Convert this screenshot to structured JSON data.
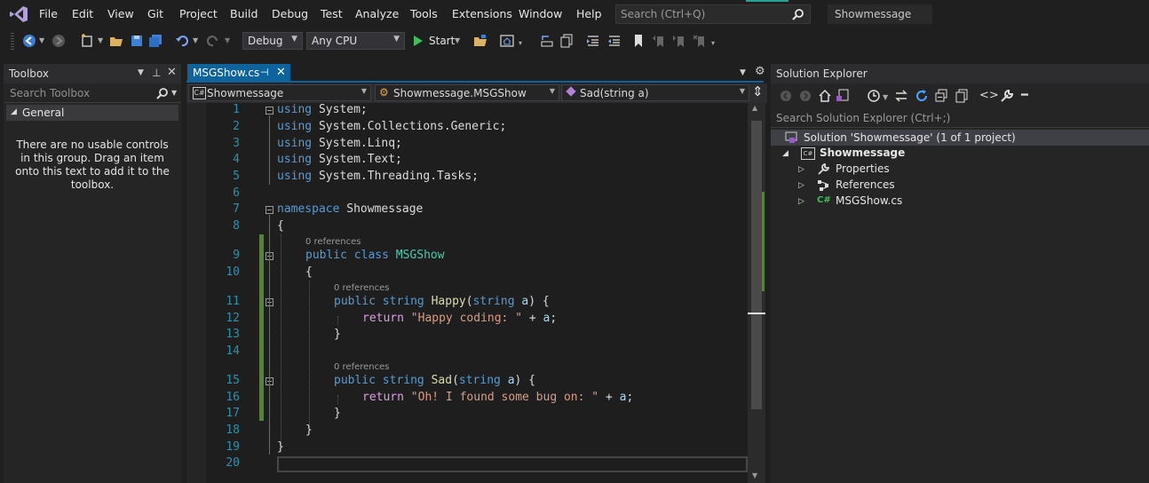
{
  "menu": [
    "File",
    "Edit",
    "View",
    "Git",
    "Project",
    "Build",
    "Debug",
    "Test",
    "Analyze",
    "Tools",
    "Extensions",
    "Window",
    "Help"
  ],
  "search": {
    "placeholder": "Search (Ctrl+Q)"
  },
  "window_title": "Showmessage",
  "toolbar": {
    "config": "Debug",
    "platform": "Any CPU",
    "start_label": "Start"
  },
  "toolbox": {
    "title": "Toolbox",
    "search_placeholder": "Search Toolbox",
    "group": "General",
    "empty_message": "There are no usable controls in this group. Drag an item onto this text to add it to the toolbox."
  },
  "editor": {
    "tab_label": "MSGShow.cs",
    "nav_project": "Showmessage",
    "nav_class": "Showmessage.MSGShow",
    "nav_member": "Sad(string a)",
    "line_numbers": [
      "1",
      "2",
      "3",
      "4",
      "5",
      "6",
      "7",
      "8",
      "9",
      "10",
      "11",
      "12",
      "13",
      "14",
      "15",
      "16",
      "17",
      "18",
      "19",
      "20"
    ],
    "lens_class": "0 references",
    "lens_happy": "0 references",
    "lens_sad": "0 references",
    "code": {
      "l1_kw": "using",
      "l1_rest": " System;",
      "l2_kw": "using",
      "l2_rest": " System.Collections.Generic;",
      "l3_kw": "using",
      "l3_rest": " System.Linq;",
      "l4_kw": "using",
      "l4_rest": " System.Text;",
      "l5_kw": "using",
      "l5_rest": " System.Threading.Tasks;",
      "l7_kw": "namespace",
      "l7_rest": " Showmessage",
      "l8": "{",
      "l9_kw1": "public",
      "l9_kw2": "class",
      "l9_type": "MSGShow",
      "l10": "{",
      "l11_kw1": "public",
      "l11_kw2": "string",
      "l11_fn": "Happy",
      "l11_p1": "(",
      "l11_kw3": "string",
      "l11_pm": "a",
      "l11_p2": ") {",
      "l12_kw": "return",
      "l12_str": "\"Happy coding: \"",
      "l12_op": " + ",
      "l12_pm": "a",
      "l12_end": ";",
      "l13": "}",
      "l15_kw1": "public",
      "l15_kw2": "string",
      "l15_fn": "Sad",
      "l15_p1": "(",
      "l15_kw3": "string",
      "l15_pm": "a",
      "l15_p2": ") {",
      "l16_kw": "return",
      "l16_str": "\"Oh! I found some bug on: \"",
      "l16_op": " + ",
      "l16_pm": "a",
      "l16_end": ";",
      "l17": "}",
      "l18": "}",
      "l19": "}"
    }
  },
  "solution_explorer": {
    "title": "Solution Explorer",
    "search_placeholder": "Search Solution Explorer (Ctrl+;)",
    "solution": "Solution 'Showmessage' (1 of 1 project)",
    "project": "Showmessage",
    "items": [
      "Properties",
      "References",
      "MSGShow.cs"
    ]
  },
  "colors": {
    "accent": "#0e639c",
    "keyword": "#569cd6",
    "type": "#4ec9b0",
    "string": "#d69d85",
    "line_number": "#2b91af"
  }
}
